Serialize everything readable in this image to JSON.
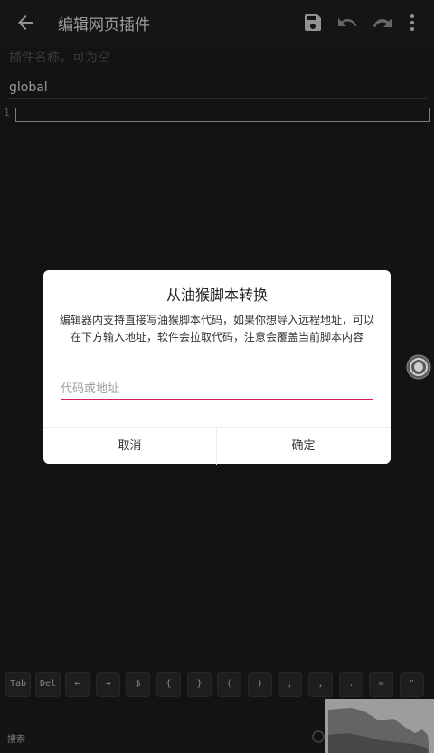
{
  "appbar": {
    "title": "编辑网页插件",
    "icons": [
      "arrow-back-icon",
      "save-icon",
      "undo-icon",
      "redo-icon",
      "more-vert-icon"
    ]
  },
  "form": {
    "name_placeholder": "插件名称，可为空",
    "scope_value": "global"
  },
  "editor": {
    "line_number": "1"
  },
  "dialog": {
    "title": "从油猴脚本转换",
    "message": "编辑器内支持直接写油猴脚本代码，如果你想导入远程地址，可以在下方输入地址，软件会拉取代码，注意会覆盖当前脚本内容",
    "input_placeholder": "代码或地址",
    "cancel_label": "取消",
    "ok_label": "确定",
    "accent_color": "#d81b60"
  },
  "keyboard_bar": {
    "keys": [
      "Tab",
      "Del",
      "←",
      "→",
      "$",
      "{",
      "}",
      "(",
      ")",
      ";",
      ",",
      ".",
      "=",
      "\""
    ]
  },
  "bottom": {
    "search_label": "搜索"
  },
  "colors": {
    "background": "#1e1e1e",
    "appbar": "#212121",
    "dialog": "#ffffff"
  }
}
